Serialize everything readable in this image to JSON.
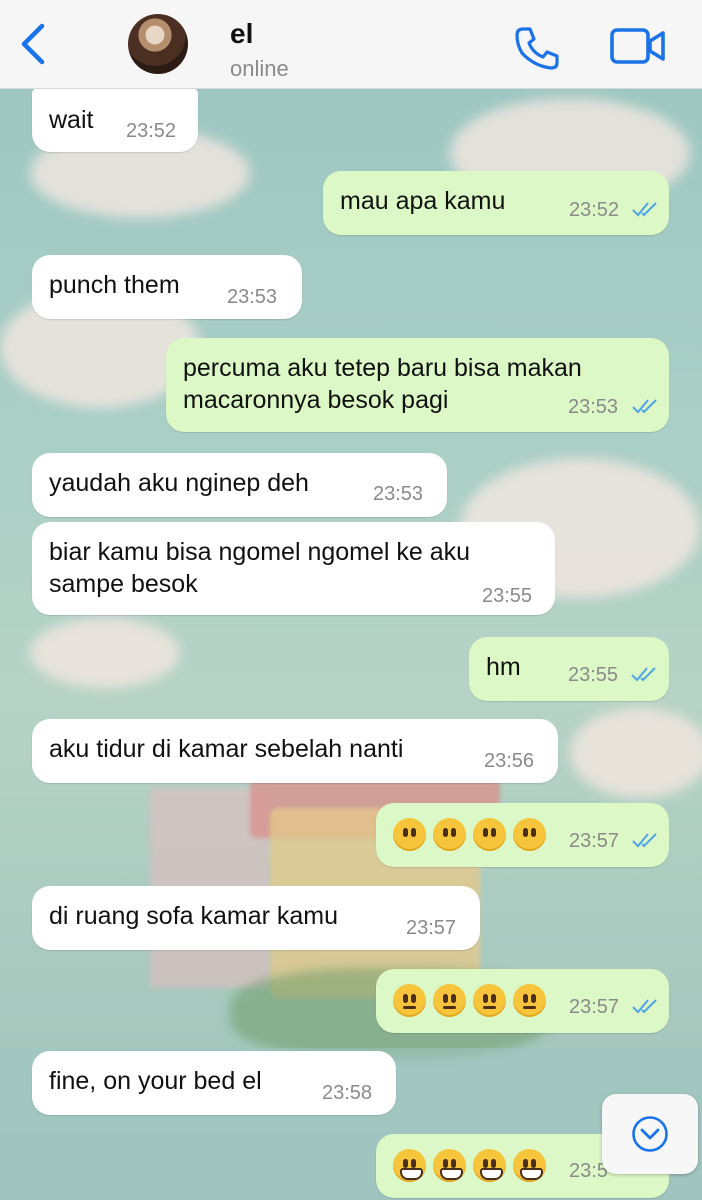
{
  "header": {
    "contact_name": "el",
    "status": "online",
    "back_icon": "chevron-left-icon",
    "call_icon": "phone-icon",
    "video_icon": "video-camera-icon",
    "accent_color": "#1a73e8"
  },
  "messages": [
    {
      "dir": "in",
      "text": "wait",
      "time": "23:52"
    },
    {
      "dir": "out",
      "text": "mau apa kamu",
      "time": "23:52",
      "read": true
    },
    {
      "dir": "in",
      "text": "punch them",
      "time": "23:53"
    },
    {
      "dir": "out",
      "text_lines": [
        "percuma aku tetep baru bisa makan",
        "macaronnya besok pagi"
      ],
      "time": "23:53",
      "read": true
    },
    {
      "dir": "in",
      "text": "yaudah aku nginep deh",
      "time": "23:53"
    },
    {
      "dir": "in",
      "text_lines": [
        "biar kamu bisa ngomel ngomel ke aku",
        "sampe besok"
      ],
      "time": "23:55"
    },
    {
      "dir": "out",
      "text": "hm",
      "time": "23:55",
      "read": true
    },
    {
      "dir": "in",
      "text": "aku tidur di kamar sebelah nanti",
      "time": "23:56"
    },
    {
      "dir": "out",
      "emoji": "face-without-mouth",
      "emoji_count": 4,
      "time": "23:57",
      "read": true
    },
    {
      "dir": "in",
      "text": "di ruang sofa kamar kamu",
      "time": "23:57"
    },
    {
      "dir": "out",
      "emoji": "neutral-face",
      "emoji_count": 4,
      "time": "23:57",
      "read": true
    },
    {
      "dir": "in",
      "text": "fine, on your bed el",
      "time": "23:58"
    },
    {
      "dir": "out",
      "emoji": "grinning-face",
      "emoji_count": 4,
      "time": "23:5",
      "read": true
    }
  ],
  "scroll_button_icon": "chevron-down-circle-icon",
  "colors": {
    "incoming": "#ffffff",
    "outgoing": "#dcf8c6",
    "tick": "#4fa3e8"
  }
}
